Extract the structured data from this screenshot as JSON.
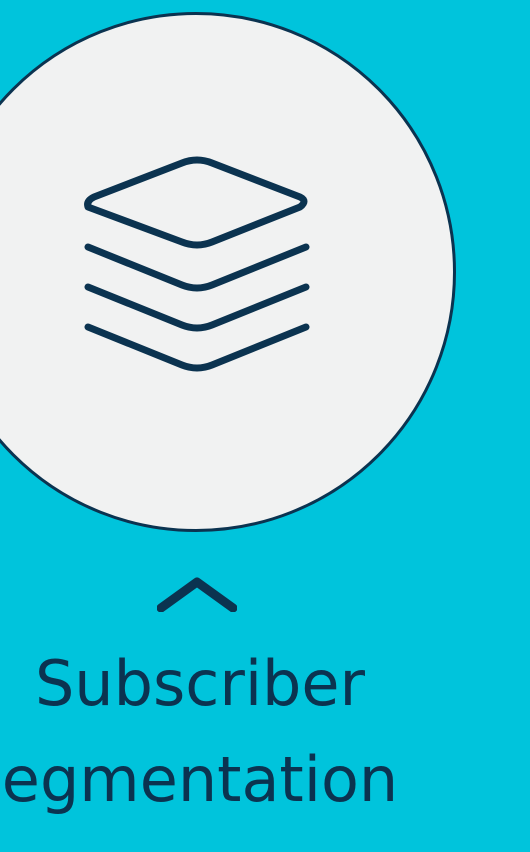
{
  "feature": {
    "icon": "layers-icon",
    "toggle_icon": "chevron-up-icon",
    "title_line1": "Subscriber",
    "title_line2": "egmentation"
  },
  "colors": {
    "background": "#00c4dc",
    "circle_fill": "#f1f2f2",
    "ink": "#0b3350"
  }
}
